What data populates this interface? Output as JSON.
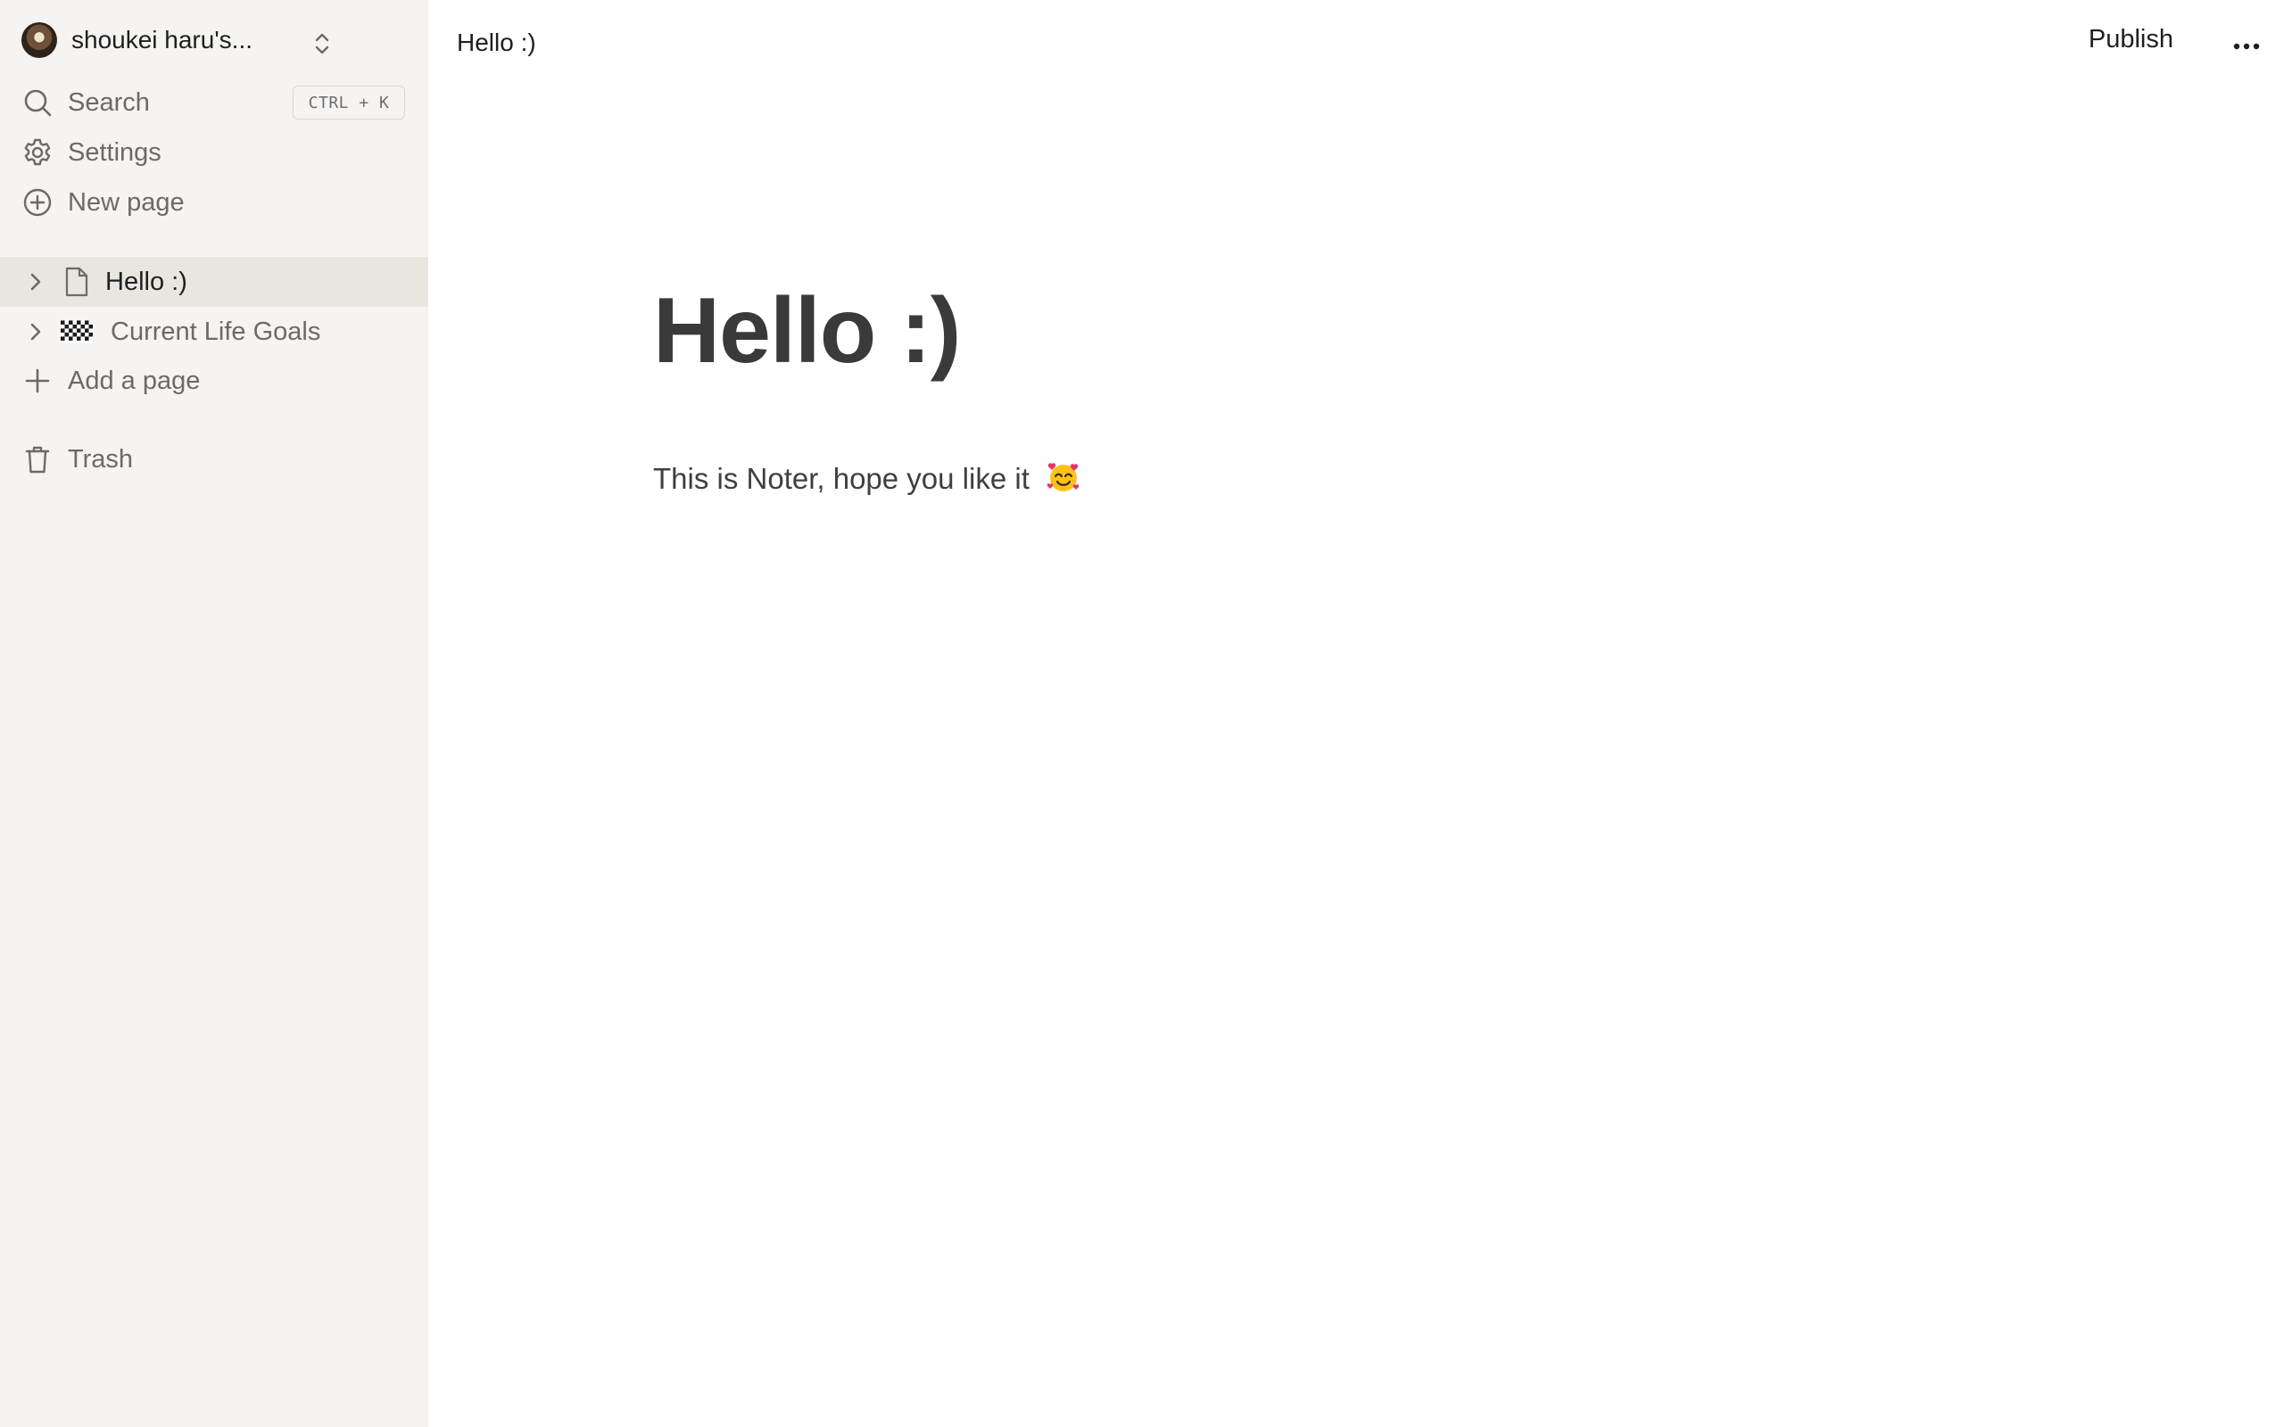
{
  "sidebar": {
    "workspace": {
      "name": "shoukei haru's..."
    },
    "nav": {
      "search_label": "Search",
      "search_shortcut": "CTRL + K",
      "settings_label": "Settings",
      "new_page_label": "New page"
    },
    "pages": [
      {
        "label": "Hello :)",
        "icon": "document-icon",
        "selected": true
      },
      {
        "label": "Current Life Goals",
        "icon": "checkered-flag-icon",
        "selected": false
      }
    ],
    "add_page_label": "Add a page",
    "trash_label": "Trash"
  },
  "topbar": {
    "breadcrumb": "Hello :)",
    "publish_label": "Publish"
  },
  "page": {
    "title": "Hello :)",
    "body_text": "This is Noter, hope you like it",
    "body_emoji": "smiling-face-with-hearts"
  }
}
